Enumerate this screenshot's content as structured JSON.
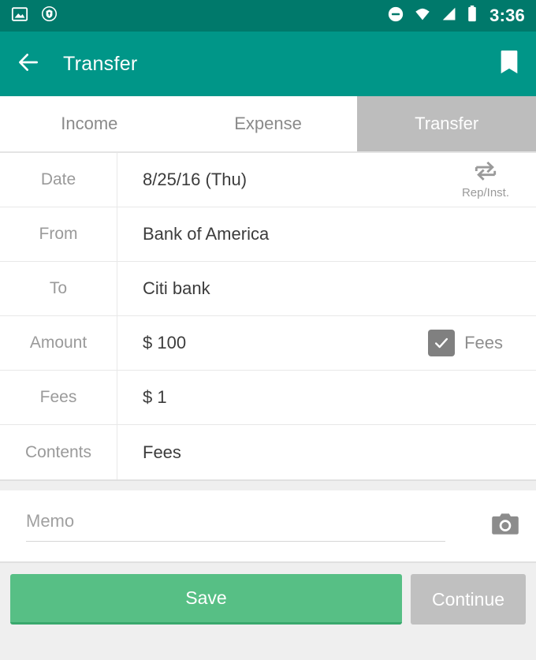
{
  "statusbar": {
    "time": "3:36",
    "left_icons": [
      "image-icon",
      "vpn-shield-icon"
    ],
    "right_icons": [
      "do-not-disturb-icon",
      "wifi-icon",
      "cellular-signal-icon",
      "battery-icon"
    ],
    "background_color": "#00796b"
  },
  "appbar": {
    "back_label": "back-arrow",
    "title": "Transfer",
    "bookmark_label": "bookmark",
    "background_color": "#009688"
  },
  "tabs": [
    {
      "label": "Income",
      "selected": false
    },
    {
      "label": "Expense",
      "selected": false
    },
    {
      "label": "Transfer",
      "selected": true
    }
  ],
  "form": {
    "rows": [
      {
        "label": "Date",
        "value": "8/25/16 (Thu)",
        "accessory": "rep-inst",
        "accessory_label": "Rep/Inst."
      },
      {
        "label": "From",
        "value": "Bank of America",
        "accessory": "none"
      },
      {
        "label": "To",
        "value": "Citi bank",
        "accessory": "none"
      },
      {
        "label": "Amount",
        "value": "$ 100",
        "accessory": "checkbox",
        "accessory_label": "Fees",
        "checked": true
      },
      {
        "label": "Fees",
        "value": "$ 1",
        "accessory": "none"
      },
      {
        "label": "Contents",
        "value": "Fees",
        "accessory": "none"
      }
    ]
  },
  "memo": {
    "placeholder": "Memo",
    "value": "",
    "camera_label": "camera"
  },
  "buttons": {
    "save_label": "Save",
    "save_color": "#57bf85",
    "continue_label": "Continue",
    "continue_color": "#c0c0c0"
  }
}
